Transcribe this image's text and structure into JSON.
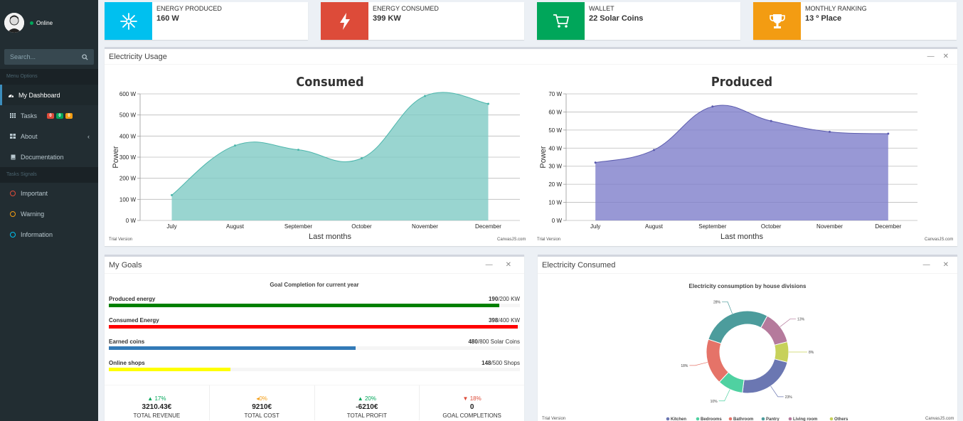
{
  "user": {
    "status": "Online"
  },
  "search": {
    "placeholder": "Search..."
  },
  "sidebar": {
    "menu_header": "Menu Options",
    "items": [
      {
        "label": "My Dashboard",
        "icon": "dashboard-icon"
      },
      {
        "label": "Tasks",
        "icon": "grid-icon",
        "badges": [
          "0",
          "0",
          "0"
        ]
      },
      {
        "label": "About",
        "icon": "grid-icon"
      },
      {
        "label": "Documentation",
        "icon": "book-icon"
      }
    ],
    "signals_header": "Tasks Signals",
    "signals": [
      {
        "label": "Important",
        "color": "#dd4b39"
      },
      {
        "label": "Warning",
        "color": "#f39c12"
      },
      {
        "label": "Information",
        "color": "#00c0ef"
      }
    ]
  },
  "info_boxes": [
    {
      "label": "ENERGY PRODUCED",
      "value": "160 W",
      "color": "#00c0ef",
      "icon": "snowflake-icon"
    },
    {
      "label": "ENERGY CONSUMED",
      "value": "399 KW",
      "color": "#dd4b39",
      "icon": "bolt-icon"
    },
    {
      "label": "WALLET",
      "value": "22 Solar Coins",
      "color": "#00a65a",
      "icon": "cart-icon"
    },
    {
      "label": "MONTHLY RANKING",
      "value": "13 º Place",
      "color": "#f39c12",
      "icon": "trophy-icon"
    }
  ],
  "usage_box": {
    "title": "Electricity Usage",
    "trial": "Trial Version",
    "credit": "CanvasJS.com"
  },
  "goals_box": {
    "title": "My Goals",
    "subtitle": "Goal Completion for current year",
    "goals": [
      {
        "label": "Produced energy",
        "current": "190",
        "total": "/200 KW",
        "pct": 0.95,
        "color": "#008000"
      },
      {
        "label": "Consumed Energy",
        "current": "398",
        "total": "/400 KW",
        "pct": 0.995,
        "color": "#ff0000"
      },
      {
        "label": "Earned coins",
        "current": "480",
        "total": "/800 Solar Coins",
        "pct": 0.6,
        "color": "#337ab7"
      },
      {
        "label": "Online shops",
        "current": "148",
        "total": "/500 Shops",
        "pct": 0.296,
        "color": "#ffff00"
      }
    ],
    "stats": [
      {
        "pct": "17%",
        "arrow": "▲",
        "color": "#00a65a",
        "amount": "3210.43€",
        "label": "TOTAL REVENUE"
      },
      {
        "pct": "0%",
        "arrow": "◂",
        "color": "#f39c12",
        "amount": "9210€",
        "label": "TOTAL COST"
      },
      {
        "pct": "20%",
        "arrow": "▲",
        "color": "#00a65a",
        "amount": "-6210€",
        "label": "TOTAL PROFIT"
      },
      {
        "pct": "18%",
        "arrow": "▼",
        "color": "#dd4b39",
        "amount": "0",
        "label": "GOAL COMPLETIONS"
      }
    ]
  },
  "consumed_box": {
    "title": "Electricity Consumed",
    "trial": "Trial Version",
    "credit": "CanvasJS.com"
  },
  "chart_data": [
    {
      "type": "area",
      "title": "Consumed",
      "xlabel": "Last months",
      "ylabel": "Power",
      "categories": [
        "July",
        "August",
        "September",
        "October",
        "November",
        "December"
      ],
      "values": [
        120,
        355,
        335,
        295,
        590,
        553
      ],
      "ylim": [
        0,
        600
      ],
      "yticks": [
        "0 W",
        "100 W",
        "200 W",
        "300 W",
        "400 W",
        "500 W",
        "600 W"
      ],
      "color": "#80cbc4",
      "line": "#4db6ac",
      "grid": true
    },
    {
      "type": "area",
      "title": "Produced",
      "xlabel": "Last months",
      "ylabel": "Power",
      "categories": [
        "July",
        "August",
        "September",
        "October",
        "November",
        "December"
      ],
      "values": [
        32,
        39,
        63,
        55,
        49,
        48
      ],
      "ylim": [
        0,
        70
      ],
      "yticks": [
        "0 W",
        "10 W",
        "20 W",
        "30 W",
        "40 W",
        "50 W",
        "60 W",
        "70 W"
      ],
      "color": "#7e7ecb",
      "line": "#5c5cae",
      "grid": true
    },
    {
      "type": "pie",
      "title": "Electricity consumption by house divisions",
      "legend": "bottom",
      "slices": [
        {
          "name": "Kitchen",
          "value": 23,
          "label": "23%",
          "color": "#6b77b2"
        },
        {
          "name": "Bedrooms",
          "value": 10,
          "label": "10%",
          "color": "#4fd1a1"
        },
        {
          "name": "Bathroom",
          "value": 18,
          "label": "18%",
          "color": "#e57368"
        },
        {
          "name": "Pantry",
          "value": 28,
          "label": "28%",
          "color": "#4c9c9c"
        },
        {
          "name": "Living room",
          "value": 13,
          "label": "13%",
          "color": "#b57a9c"
        },
        {
          "name": "Others",
          "value": 8,
          "label": "8%",
          "color": "#c7d15a"
        }
      ]
    }
  ]
}
